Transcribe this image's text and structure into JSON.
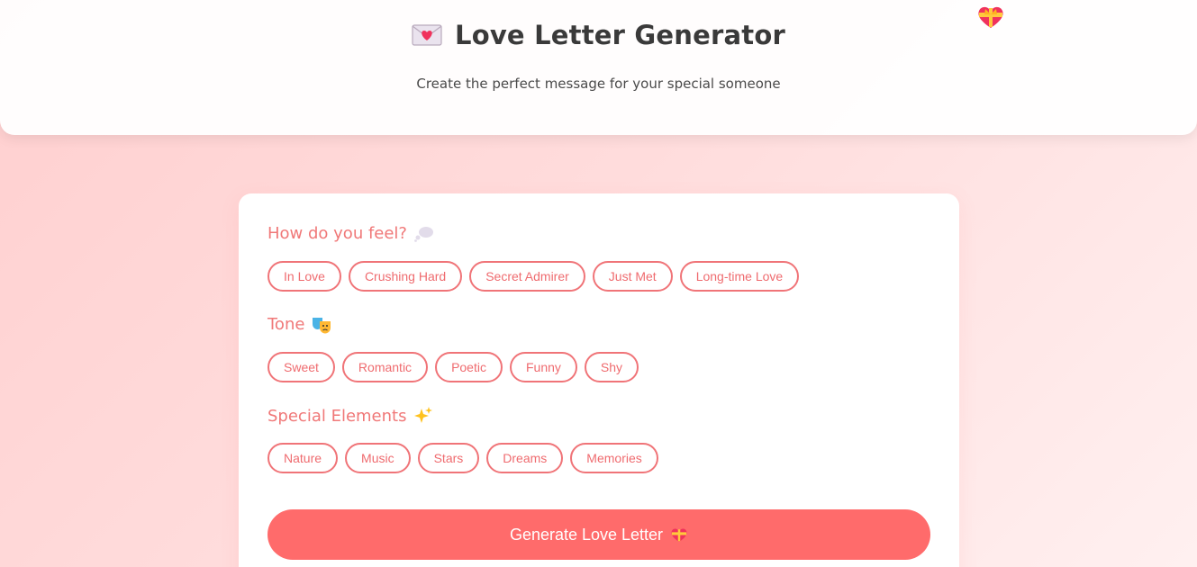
{
  "header": {
    "title": "Love Letter Generator",
    "subtitle": "Create the perfect message for your special someone",
    "title_icon": "love-letter-envelope-icon",
    "floating_icon": "heart-with-ribbon-icon"
  },
  "form": {
    "sections": [
      {
        "label": "How do you feel?",
        "icon": "thought-bubble-icon",
        "options": [
          "In Love",
          "Crushing Hard",
          "Secret Admirer",
          "Just Met",
          "Long-time Love"
        ]
      },
      {
        "label": "Tone",
        "icon": "theater-masks-icon",
        "options": [
          "Sweet",
          "Romantic",
          "Poetic",
          "Funny",
          "Shy"
        ]
      },
      {
        "label": "Special Elements",
        "icon": "sparkles-icon",
        "options": [
          "Nature",
          "Music",
          "Stars",
          "Dreams",
          "Memories"
        ]
      }
    ],
    "generate_label": "Generate Love Letter",
    "generate_icon": "heart-with-ribbon-icon"
  },
  "colors": {
    "accent": "#ff6b6b",
    "chip_border": "#f07478",
    "label": "#f07878",
    "title": "#3a3a3a"
  }
}
